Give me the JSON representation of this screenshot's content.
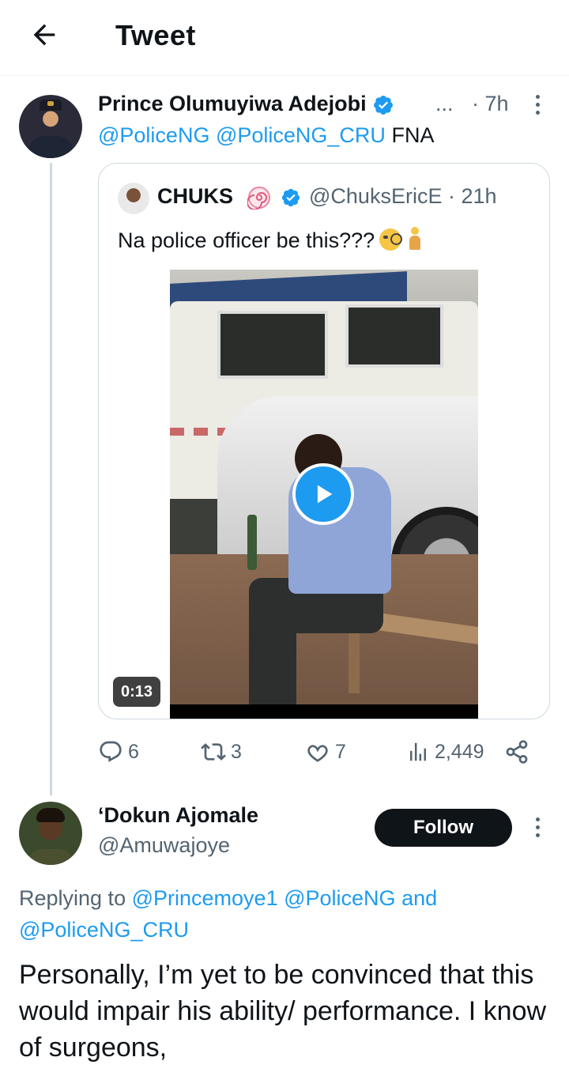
{
  "header": {
    "title": "Tweet"
  },
  "tweet1": {
    "name": "Prince Olumuyiwa Adejobi",
    "ellipsis": "...",
    "time": "· 7h",
    "mention1": "@PoliceNG",
    "mention2": "@PoliceNG_CRU",
    "text": "FNA",
    "quoted": {
      "name": "CHUKS",
      "handle_time": "@ChuksEricE · 21h",
      "text": "Na police officer be this???",
      "video_duration": "0:13"
    },
    "stats": {
      "replies": "6",
      "retweets": "3",
      "likes": "7",
      "views": "2,449"
    }
  },
  "tweet2": {
    "name": "‘Dokun Ajomale",
    "handle": "@Amuwajoye",
    "follow_label": "Follow",
    "replying_prefix": "Replying to",
    "replying_mention1": "@Princemoye1",
    "replying_mention2": "@PoliceNG",
    "replying_and": "and",
    "replying_mention3": "@PoliceNG_CRU",
    "text": "Personally, I’m yet to be convinced that this would impair his ability/ performance. I know of surgeons,"
  },
  "colors": {
    "accent": "#1d9bf0",
    "text_primary": "#0f1419",
    "text_secondary": "#536471",
    "border": "#cfd9de"
  },
  "icons": [
    "back-arrow-icon",
    "verified-badge-icon",
    "more-vertical-icon",
    "spiral-emoji-icon",
    "play-icon",
    "reply-icon",
    "retweet-icon",
    "like-icon",
    "views-icon",
    "share-icon"
  ]
}
